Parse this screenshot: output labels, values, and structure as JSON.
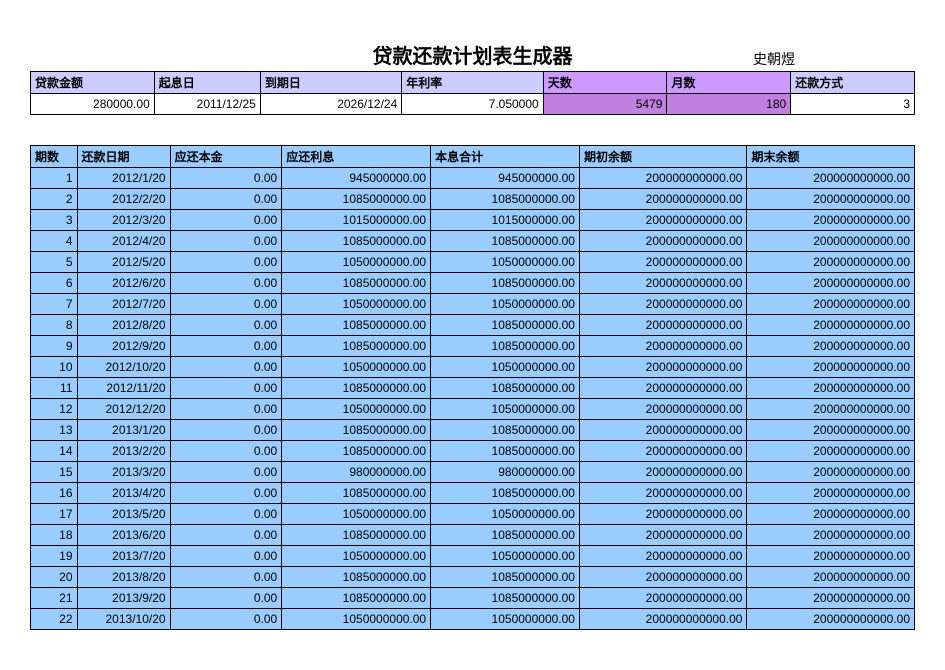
{
  "title": "贷款还款计划表生成器",
  "author": "史朝煜",
  "params": {
    "headers": {
      "amount": "贷款金额",
      "start": "起息日",
      "end": "到期日",
      "rate": "年利率",
      "days": "天数",
      "months": "月数",
      "method": "还款方式"
    },
    "values": {
      "amount": "280000.00",
      "start": "2011/12/25",
      "end": "2026/12/24",
      "rate": "7.050000",
      "days": "5479",
      "months": "180",
      "method": "3"
    }
  },
  "schedule": {
    "headers": {
      "period": "期数",
      "date": "还款日期",
      "principal": "应还本金",
      "interest": "应还利息",
      "total": "本息合计",
      "startBal": "期初余额",
      "endBal": "期末余额"
    },
    "rows": [
      {
        "n": "1",
        "date": "2012/1/20",
        "principal": "0.00",
        "interest": "945000000.00",
        "total": "945000000.00",
        "startBal": "200000000000.00",
        "endBal": "200000000000.00"
      },
      {
        "n": "2",
        "date": "2012/2/20",
        "principal": "0.00",
        "interest": "1085000000.00",
        "total": "1085000000.00",
        "startBal": "200000000000.00",
        "endBal": "200000000000.00"
      },
      {
        "n": "3",
        "date": "2012/3/20",
        "principal": "0.00",
        "interest": "1015000000.00",
        "total": "1015000000.00",
        "startBal": "200000000000.00",
        "endBal": "200000000000.00"
      },
      {
        "n": "4",
        "date": "2012/4/20",
        "principal": "0.00",
        "interest": "1085000000.00",
        "total": "1085000000.00",
        "startBal": "200000000000.00",
        "endBal": "200000000000.00"
      },
      {
        "n": "5",
        "date": "2012/5/20",
        "principal": "0.00",
        "interest": "1050000000.00",
        "total": "1050000000.00",
        "startBal": "200000000000.00",
        "endBal": "200000000000.00"
      },
      {
        "n": "6",
        "date": "2012/6/20",
        "principal": "0.00",
        "interest": "1085000000.00",
        "total": "1085000000.00",
        "startBal": "200000000000.00",
        "endBal": "200000000000.00"
      },
      {
        "n": "7",
        "date": "2012/7/20",
        "principal": "0.00",
        "interest": "1050000000.00",
        "total": "1050000000.00",
        "startBal": "200000000000.00",
        "endBal": "200000000000.00"
      },
      {
        "n": "8",
        "date": "2012/8/20",
        "principal": "0.00",
        "interest": "1085000000.00",
        "total": "1085000000.00",
        "startBal": "200000000000.00",
        "endBal": "200000000000.00"
      },
      {
        "n": "9",
        "date": "2012/9/20",
        "principal": "0.00",
        "interest": "1085000000.00",
        "total": "1085000000.00",
        "startBal": "200000000000.00",
        "endBal": "200000000000.00"
      },
      {
        "n": "10",
        "date": "2012/10/20",
        "principal": "0.00",
        "interest": "1050000000.00",
        "total": "1050000000.00",
        "startBal": "200000000000.00",
        "endBal": "200000000000.00"
      },
      {
        "n": "11",
        "date": "2012/11/20",
        "principal": "0.00",
        "interest": "1085000000.00",
        "total": "1085000000.00",
        "startBal": "200000000000.00",
        "endBal": "200000000000.00"
      },
      {
        "n": "12",
        "date": "2012/12/20",
        "principal": "0.00",
        "interest": "1050000000.00",
        "total": "1050000000.00",
        "startBal": "200000000000.00",
        "endBal": "200000000000.00"
      },
      {
        "n": "13",
        "date": "2013/1/20",
        "principal": "0.00",
        "interest": "1085000000.00",
        "total": "1085000000.00",
        "startBal": "200000000000.00",
        "endBal": "200000000000.00"
      },
      {
        "n": "14",
        "date": "2013/2/20",
        "principal": "0.00",
        "interest": "1085000000.00",
        "total": "1085000000.00",
        "startBal": "200000000000.00",
        "endBal": "200000000000.00"
      },
      {
        "n": "15",
        "date": "2013/3/20",
        "principal": "0.00",
        "interest": "980000000.00",
        "total": "980000000.00",
        "startBal": "200000000000.00",
        "endBal": "200000000000.00"
      },
      {
        "n": "16",
        "date": "2013/4/20",
        "principal": "0.00",
        "interest": "1085000000.00",
        "total": "1085000000.00",
        "startBal": "200000000000.00",
        "endBal": "200000000000.00"
      },
      {
        "n": "17",
        "date": "2013/5/20",
        "principal": "0.00",
        "interest": "1050000000.00",
        "total": "1050000000.00",
        "startBal": "200000000000.00",
        "endBal": "200000000000.00"
      },
      {
        "n": "18",
        "date": "2013/6/20",
        "principal": "0.00",
        "interest": "1085000000.00",
        "total": "1085000000.00",
        "startBal": "200000000000.00",
        "endBal": "200000000000.00"
      },
      {
        "n": "19",
        "date": "2013/7/20",
        "principal": "0.00",
        "interest": "1050000000.00",
        "total": "1050000000.00",
        "startBal": "200000000000.00",
        "endBal": "200000000000.00"
      },
      {
        "n": "20",
        "date": "2013/8/20",
        "principal": "0.00",
        "interest": "1085000000.00",
        "total": "1085000000.00",
        "startBal": "200000000000.00",
        "endBal": "200000000000.00"
      },
      {
        "n": "21",
        "date": "2013/9/20",
        "principal": "0.00",
        "interest": "1085000000.00",
        "total": "1085000000.00",
        "startBal": "200000000000.00",
        "endBal": "200000000000.00"
      },
      {
        "n": "22",
        "date": "2013/10/20",
        "principal": "0.00",
        "interest": "1050000000.00",
        "total": "1050000000.00",
        "startBal": "200000000000.00",
        "endBal": "200000000000.00"
      }
    ]
  }
}
